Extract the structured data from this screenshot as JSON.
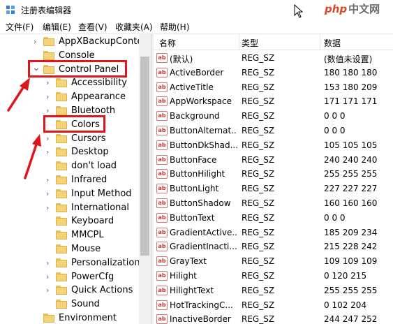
{
  "window": {
    "title": "注册表编辑器",
    "watermark_brand": "php",
    "watermark_site": "中文网"
  },
  "menu": [
    "文件(F)",
    "编辑(E)",
    "查看(V)",
    "收藏夹(A)",
    "帮助(H)"
  ],
  "tree": {
    "items": [
      {
        "label": "AppXBackupConter",
        "level": 1,
        "expander": "collapsed"
      },
      {
        "label": "Console",
        "level": 1,
        "expander": "none"
      },
      {
        "label": "Control Panel",
        "level": 1,
        "expander": "expanded",
        "highlighted": true
      },
      {
        "label": "Accessibility",
        "level": 2,
        "expander": "collapsed"
      },
      {
        "label": "Appearance",
        "level": 2,
        "expander": "collapsed"
      },
      {
        "label": "Bluetooth",
        "level": 2,
        "expander": "collapsed"
      },
      {
        "label": "Colors",
        "level": 2,
        "expander": "none",
        "selected": true,
        "highlighted": true
      },
      {
        "label": "Cursors",
        "level": 2,
        "expander": "collapsed"
      },
      {
        "label": "Desktop",
        "level": 2,
        "expander": "collapsed"
      },
      {
        "label": "don't load",
        "level": 2,
        "expander": "none"
      },
      {
        "label": "Infrared",
        "level": 2,
        "expander": "collapsed"
      },
      {
        "label": "Input Method",
        "level": 2,
        "expander": "collapsed"
      },
      {
        "label": "International",
        "level": 2,
        "expander": "collapsed"
      },
      {
        "label": "Keyboard",
        "level": 2,
        "expander": "none"
      },
      {
        "label": "MMCPL",
        "level": 2,
        "expander": "none"
      },
      {
        "label": "Mouse",
        "level": 2,
        "expander": "none"
      },
      {
        "label": "Personalization",
        "level": 2,
        "expander": "collapsed"
      },
      {
        "label": "PowerCfg",
        "level": 2,
        "expander": "collapsed"
      },
      {
        "label": "Quick Actions",
        "level": 2,
        "expander": "collapsed"
      },
      {
        "label": "Sound",
        "level": 2,
        "expander": "none"
      },
      {
        "label": "Environment",
        "level": 1,
        "expander": "none"
      }
    ]
  },
  "list": {
    "columns": [
      "名称",
      "类型",
      "数据"
    ],
    "rows": [
      {
        "name": "(默认)",
        "type": "REG_SZ",
        "data": "(数值未设置)"
      },
      {
        "name": "ActiveBorder",
        "type": "REG_SZ",
        "data": "180 180 180"
      },
      {
        "name": "ActiveTitle",
        "type": "REG_SZ",
        "data": "153 180 209"
      },
      {
        "name": "AppWorkspace",
        "type": "REG_SZ",
        "data": "171 171 171"
      },
      {
        "name": "Background",
        "type": "REG_SZ",
        "data": "0 0 0"
      },
      {
        "name": "ButtonAlternat...",
        "type": "REG_SZ",
        "data": "0 0 0"
      },
      {
        "name": "ButtonDkShad...",
        "type": "REG_SZ",
        "data": "105 105 105"
      },
      {
        "name": "ButtonFace",
        "type": "REG_SZ",
        "data": "240 240 240"
      },
      {
        "name": "ButtonHilight",
        "type": "REG_SZ",
        "data": "255 255 255"
      },
      {
        "name": "ButtonLight",
        "type": "REG_SZ",
        "data": "227 227 227"
      },
      {
        "name": "ButtonShadow",
        "type": "REG_SZ",
        "data": "160 160 160"
      },
      {
        "name": "ButtonText",
        "type": "REG_SZ",
        "data": "0 0 0"
      },
      {
        "name": "GradientActive...",
        "type": "REG_SZ",
        "data": "185 209 234"
      },
      {
        "name": "GradientInacti...",
        "type": "REG_SZ",
        "data": "215 228 242"
      },
      {
        "name": "GrayText",
        "type": "REG_SZ",
        "data": "109 109 109"
      },
      {
        "name": "Hilight",
        "type": "REG_SZ",
        "data": "0 120 215"
      },
      {
        "name": "HilightText",
        "type": "REG_SZ",
        "data": "255 255 255"
      },
      {
        "name": "HotTrackingC...",
        "type": "REG_SZ",
        "data": "0 102 204"
      },
      {
        "name": "InactiveBorder",
        "type": "REG_SZ",
        "data": "244 247 252"
      }
    ],
    "value_icon": "ab-string-icon"
  },
  "colors": {
    "annotation": "#e0151b",
    "folder": "#f5d37a"
  }
}
